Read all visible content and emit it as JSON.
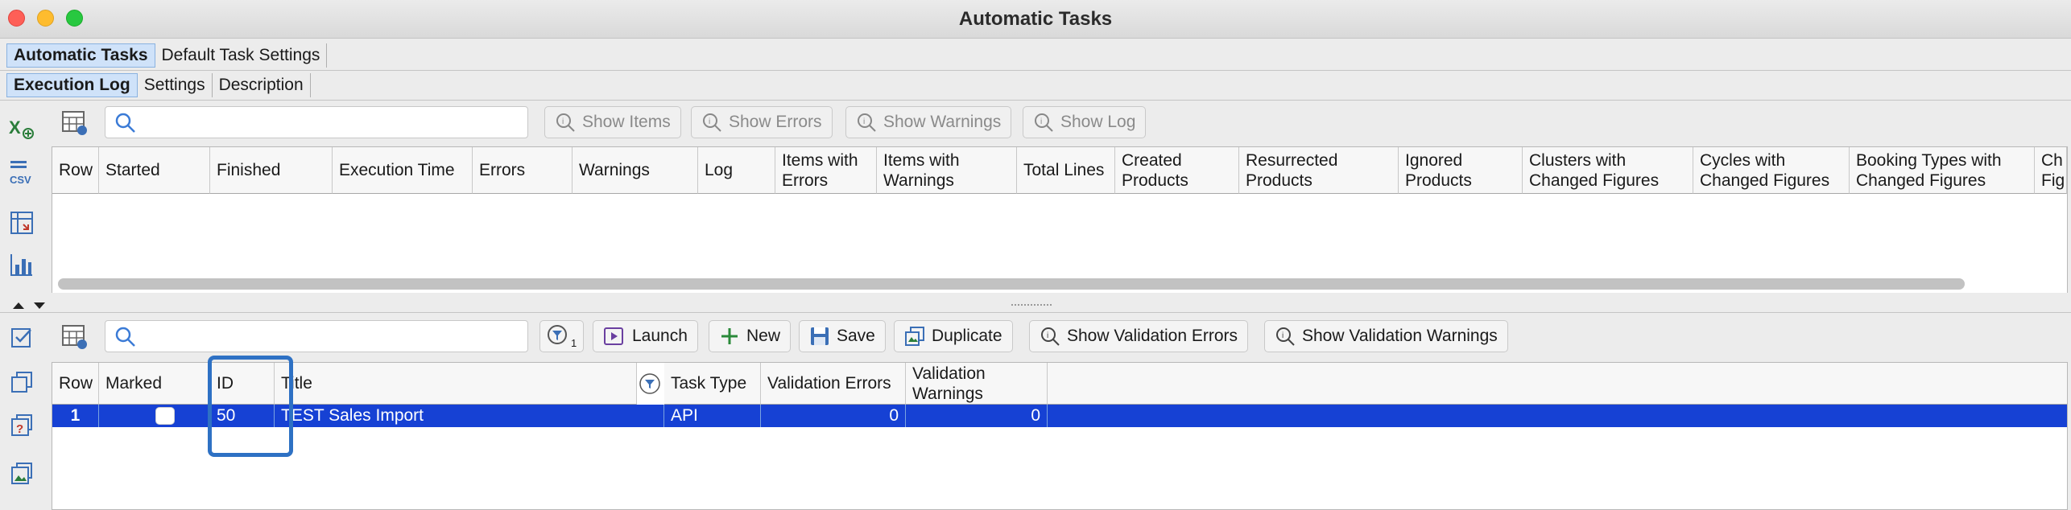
{
  "window": {
    "title": "Automatic Tasks"
  },
  "main_tabs": [
    {
      "label": "Automatic Tasks",
      "active": true
    },
    {
      "label": "Default Task Settings",
      "active": false
    }
  ],
  "sub_tabs": [
    {
      "label": "Execution Log",
      "active": true
    },
    {
      "label": "Settings",
      "active": false
    },
    {
      "label": "Description",
      "active": false
    }
  ],
  "log_toolbar": {
    "search_placeholder": "",
    "buttons": [
      "Show Items",
      "Show Errors",
      "Show Warnings",
      "Show Log"
    ]
  },
  "log_table": {
    "columns": [
      "Row",
      "Started",
      "Finished",
      "Execution Time",
      "Errors",
      "Warnings",
      "Log",
      "Items with Errors",
      "Items with Warnings",
      "Total Lines",
      "Created Products",
      "Resurrected Products",
      "Ignored Products",
      "Clusters with Changed Figures",
      "Cycles with Changed Figures",
      "Booking Types with Changed Figures",
      "Ch Fig"
    ],
    "rows": []
  },
  "tasks_toolbar": {
    "search_placeholder": "",
    "filter_badge": "1",
    "buttons": [
      "Launch",
      "New",
      "Save",
      "Duplicate",
      "Show Validation Errors",
      "Show Validation Warnings"
    ]
  },
  "tasks_table": {
    "columns": [
      "Row",
      "Marked",
      "ID",
      "Title",
      "Task Type",
      "Validation Errors",
      "Validation Warnings"
    ],
    "rows": [
      {
        "row": "1",
        "marked": false,
        "id": "50",
        "title": "TEST Sales Import",
        "task_type": "API",
        "validation_errors": "0",
        "validation_warnings": "0"
      }
    ]
  },
  "colors": {
    "selection": "#1641d4",
    "highlight_box": "#2e71c4",
    "active_tab": "#cfe2f9"
  }
}
